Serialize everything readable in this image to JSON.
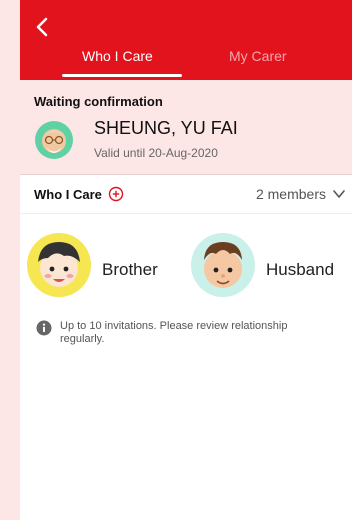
{
  "header": {
    "tabs": [
      {
        "label": "Who I Care",
        "active": true
      },
      {
        "label": "My Carer",
        "active": false
      }
    ]
  },
  "waiting": {
    "title": "Waiting confirmation",
    "name": "SHEUNG, YU FAI",
    "valid": "Valid until 20-Aug-2020"
  },
  "section": {
    "title": "Who I Care",
    "members_count": "2 members"
  },
  "members": [
    {
      "label": "Brother"
    },
    {
      "label": "Husband"
    }
  ],
  "note": "Up to 10 invitations. Please review relationship regularly.",
  "colors": {
    "accent": "#e3131d",
    "tint": "#fde6e6"
  },
  "icons": [
    "back-arrow-icon",
    "add-circle-icon",
    "chevron-down-icon",
    "info-icon"
  ]
}
